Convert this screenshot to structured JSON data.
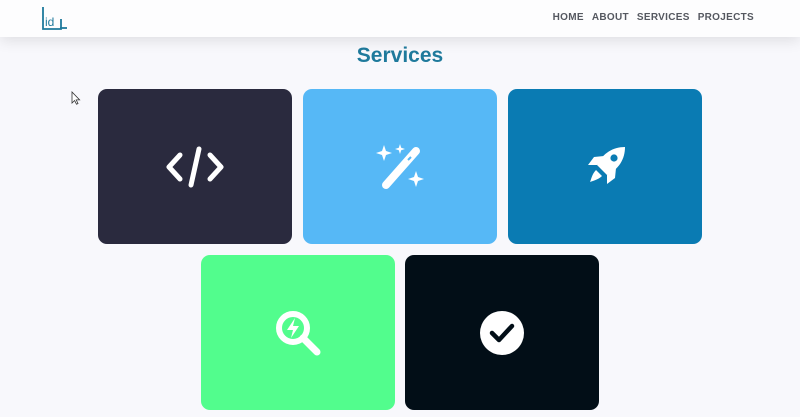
{
  "nav": {
    "logo_text": "id_",
    "links": [
      "HOME",
      "ABOUT",
      "SERVICES",
      "PROJECTS"
    ]
  },
  "services": {
    "title": "Services",
    "cards": [
      {
        "icon": "code-icon",
        "color": "#2a2a3e"
      },
      {
        "icon": "magic-wand-icon",
        "color": "#56b8f6"
      },
      {
        "icon": "rocket-icon",
        "color": "#0a7bb3"
      },
      {
        "icon": "search-bolt-icon",
        "color": "#52fd8d"
      },
      {
        "icon": "check-circle-icon",
        "color": "#020e17"
      }
    ]
  },
  "colors": {
    "accent": "#1f7a9c",
    "background": "#f8f8fc",
    "nav_text": "#555860"
  }
}
